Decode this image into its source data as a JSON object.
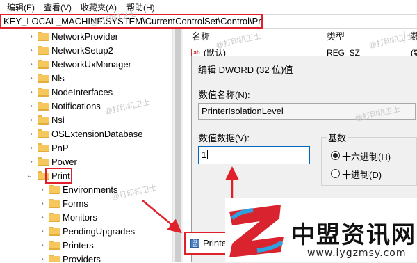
{
  "menu": {
    "items": [
      "编辑(E)",
      "查看(V)",
      "收藏夹(A)",
      "帮助(H)"
    ]
  },
  "address": {
    "path": "KEY_LOCAL_MACHINE\\SYSTEM\\CurrentControlSet\\Control\\Print"
  },
  "tree": {
    "items": [
      {
        "label": "NetworkProvider"
      },
      {
        "label": "NetworkSetup2"
      },
      {
        "label": "NetworkUxManager"
      },
      {
        "label": "Nls"
      },
      {
        "label": "NodeInterfaces"
      },
      {
        "label": "Notifications"
      },
      {
        "label": "Nsi"
      },
      {
        "label": "OSExtensionDatabase"
      },
      {
        "label": "PnP"
      },
      {
        "label": "Power"
      },
      {
        "label": "Print"
      },
      {
        "label": "Environments"
      },
      {
        "label": "Forms"
      },
      {
        "label": "Monitors"
      },
      {
        "label": "PendingUpgrades"
      },
      {
        "label": "Printers"
      },
      {
        "label": "Providers"
      }
    ]
  },
  "list": {
    "col_name": "名称",
    "col_type": "类型",
    "col_data": "数",
    "rows": [
      {
        "name": "(默认)",
        "type": "REG_SZ",
        "data": "(数"
      }
    ],
    "bottom_item": "Printe"
  },
  "dialog": {
    "title": "编辑 DWORD (32 位)值",
    "name_label": "数值名称(N):",
    "name_value": "PrinterIsolationLevel",
    "data_label": "数值数据(V):",
    "data_value": "1",
    "base_label": "基数",
    "hex_label": "十六进制(H)",
    "dec_label": "十进制(D)"
  },
  "watermark": "@打印机卫士",
  "logo": {
    "name": "中盟资讯网",
    "url": "www.lygzmsy.com"
  },
  "colors": {
    "highlight_red": "#e0202a",
    "folder": "#f5c75c",
    "dialog_bg": "#f0f0f0"
  }
}
